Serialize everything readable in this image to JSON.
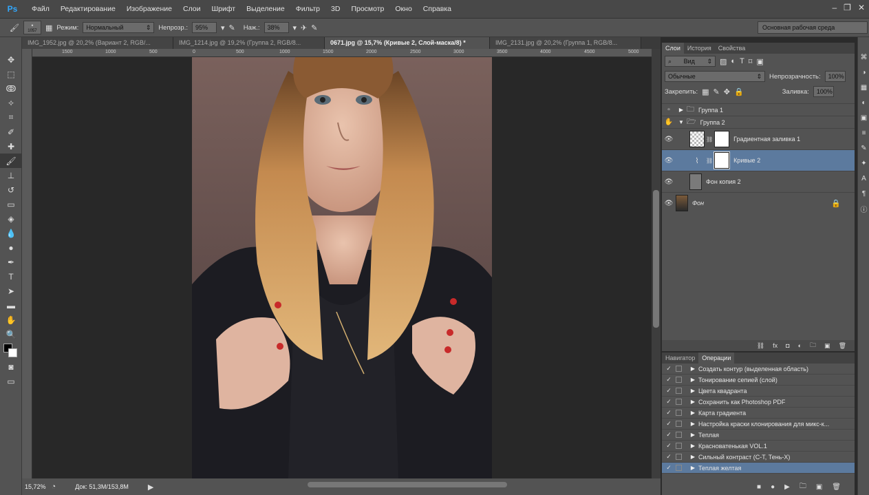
{
  "menubar": {
    "logo": "Ps",
    "items": [
      "Файл",
      "Редактирование",
      "Изображение",
      "Слои",
      "Шрифт",
      "Выделение",
      "Фильтр",
      "3D",
      "Просмотр",
      "Окно",
      "Справка"
    ]
  },
  "options": {
    "brush_size": "1057",
    "mode_label": "Режим:",
    "mode_value": "Нормальный",
    "opacity_label": "Непрозр.:",
    "opacity_value": "95%",
    "pressure_label": "Наж.:",
    "pressure_value": "38%",
    "workspace": "Основная рабочая среда"
  },
  "tabs": [
    "IMG_1952.jpg @ 20,2% (Вариант 2, RGB/...",
    "IMG_1214.jpg @ 19,2% (Группа 2, RGB/8...",
    "0671.jpg @ 15,7% (Кривые 2, Слой-маска/8) *",
    "IMG_2131.jpg @ 20,2% (Группа 1, RGB/8..."
  ],
  "ruler_ticks": [
    "1500",
    "1000",
    "500",
    "0",
    "500",
    "1000",
    "1500",
    "2000",
    "2500",
    "3000",
    "3500",
    "4000",
    "4500",
    "5000"
  ],
  "status": {
    "zoom": "15,72%",
    "doc": "Док: 51,3M/153,8M"
  },
  "layers_panel": {
    "tabs": [
      "Слои",
      "История",
      "Свойства"
    ],
    "kind": "Вид",
    "blend": "Обычные",
    "opacity_label": "Непрозрачность:",
    "opacity_value": "100%",
    "lock_label": "Закрепить:",
    "fill_label": "Заливка:",
    "fill_value": "100%",
    "layers": [
      {
        "name": "Группа 1"
      },
      {
        "name": "Группа 2"
      },
      {
        "name": "Градиентная заливка 1"
      },
      {
        "name": "Кривые 2"
      },
      {
        "name": "Фон копия 2"
      },
      {
        "name": "Фон"
      }
    ]
  },
  "actions_panel": {
    "tabs": [
      "Навигатор",
      "Операции"
    ],
    "items": [
      "Создать контур (выделенная область)",
      "Тонирование сепией (слой)",
      "Цвета квадранта",
      "Сохранить как Photoshop PDF",
      "Карта градиента",
      "Настройка краски клонирования для микс-к...",
      "Теплая",
      "Красноватенькая VOL.1",
      "Сильный контраст (С-Т, Тень-Х)",
      "Теплая желтая"
    ]
  },
  "colors": {
    "accent_select": "#5c7a9e",
    "ps_blue": "#31a8ff",
    "nail": "#c82a2a"
  }
}
